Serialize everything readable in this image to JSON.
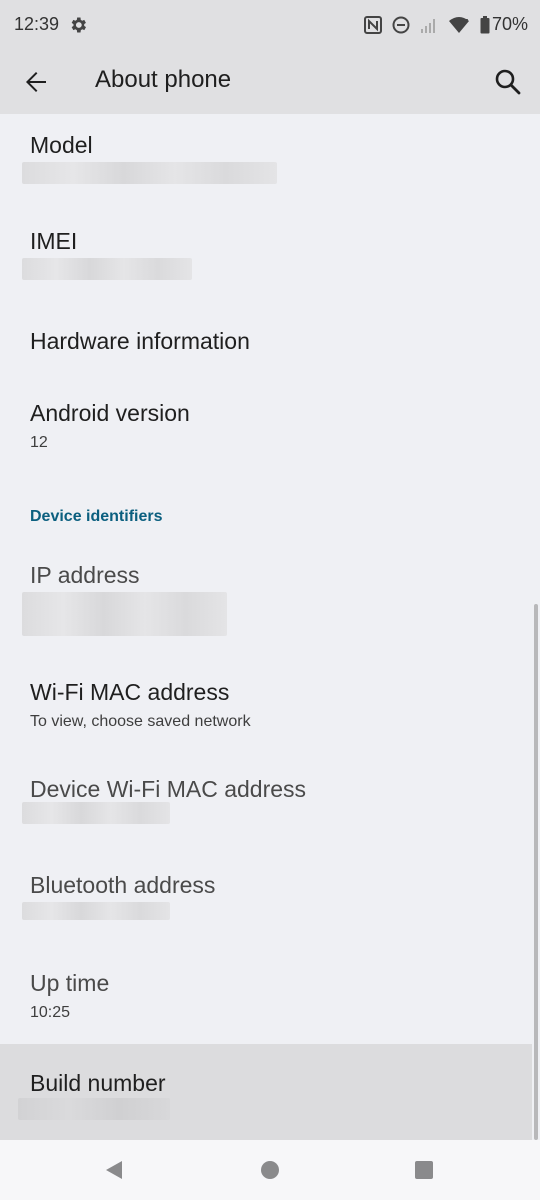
{
  "status_bar": {
    "time": "12:39",
    "battery_percent": "70%",
    "icons": [
      "gear-icon",
      "nfc-icon",
      "do-not-disturb-icon",
      "signal-icon",
      "wifi-icon",
      "battery-icon"
    ]
  },
  "app_bar": {
    "title": "About phone",
    "back_icon": "arrow-back-icon",
    "search_icon": "search-icon"
  },
  "items": {
    "model": {
      "title": "Model"
    },
    "imei": {
      "title": "IMEI"
    },
    "hardware": {
      "title": "Hardware information"
    },
    "android_version": {
      "title": "Android version",
      "value": "12"
    },
    "section_device_identifiers": "Device identifiers",
    "ip_address": {
      "title": "IP address"
    },
    "wifi_mac": {
      "title": "Wi-Fi MAC address",
      "value": "To view, choose saved network"
    },
    "device_wifi_mac": {
      "title": "Device Wi-Fi MAC address"
    },
    "bluetooth": {
      "title": "Bluetooth address"
    },
    "uptime": {
      "title": "Up time",
      "value": "10:25"
    },
    "build_number": {
      "title": "Build number"
    }
  },
  "nav_bar": {
    "icons": [
      "back-triangle-icon",
      "home-circle-icon",
      "recents-square-icon"
    ]
  },
  "colors": {
    "background": "#eff0f4",
    "app_bar": "#e0e0e2",
    "section_header": "#0b5f7f",
    "highlight_row": "#dcdcde"
  }
}
